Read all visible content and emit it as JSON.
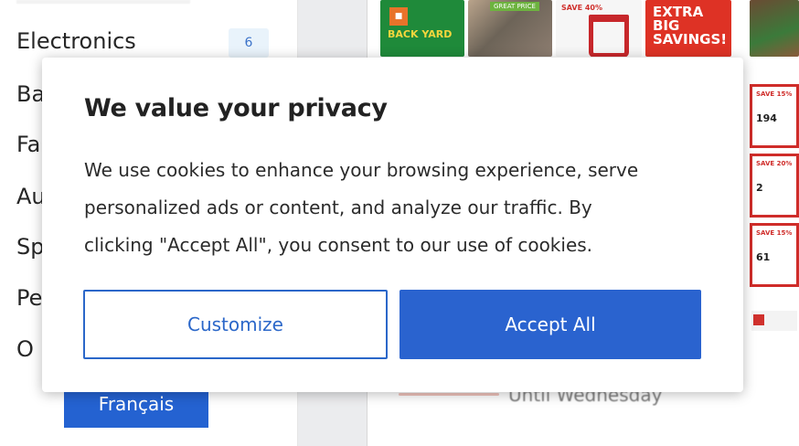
{
  "sidebar": {
    "categories": [
      {
        "label": "Electronics",
        "count": "6"
      },
      {
        "label": "Ba"
      },
      {
        "label": "Fa"
      },
      {
        "label": "Au"
      },
      {
        "label": "Sp"
      },
      {
        "label": "Pe"
      },
      {
        "label": "O"
      }
    ],
    "language_button": "Français"
  },
  "main": {
    "promos": {
      "green_text": "BACK YARD",
      "photo_badge": "GREAT PRICE",
      "chair_badge": "SAVE 40%",
      "red_text_line1": "EXTRA",
      "red_text_line2": "BIG",
      "red_text_line3": "SAVINGS!"
    },
    "tiles": [
      {
        "tag": "SAVE 15%",
        "price": "194"
      },
      {
        "tag": "SAVE 20%",
        "price": "2"
      },
      {
        "tag": "SAVE 15%",
        "price": "61"
      }
    ],
    "flyer_caption": "Until Wednesday"
  },
  "modal": {
    "title": "We value your privacy",
    "body_lines": [
      "We use cookies to enhance your browsing experience, serve",
      "personalized ads or content, and analyze our traffic. By",
      "clicking \"Accept All\", you consent to our use of cookies."
    ],
    "customize_label": "Customize",
    "accept_label": "Accept All"
  },
  "colors": {
    "primary": "#2a63cf",
    "badge_bg": "#e9f3fb",
    "promo_red": "#de3225",
    "promo_green": "#1f8a3a"
  }
}
